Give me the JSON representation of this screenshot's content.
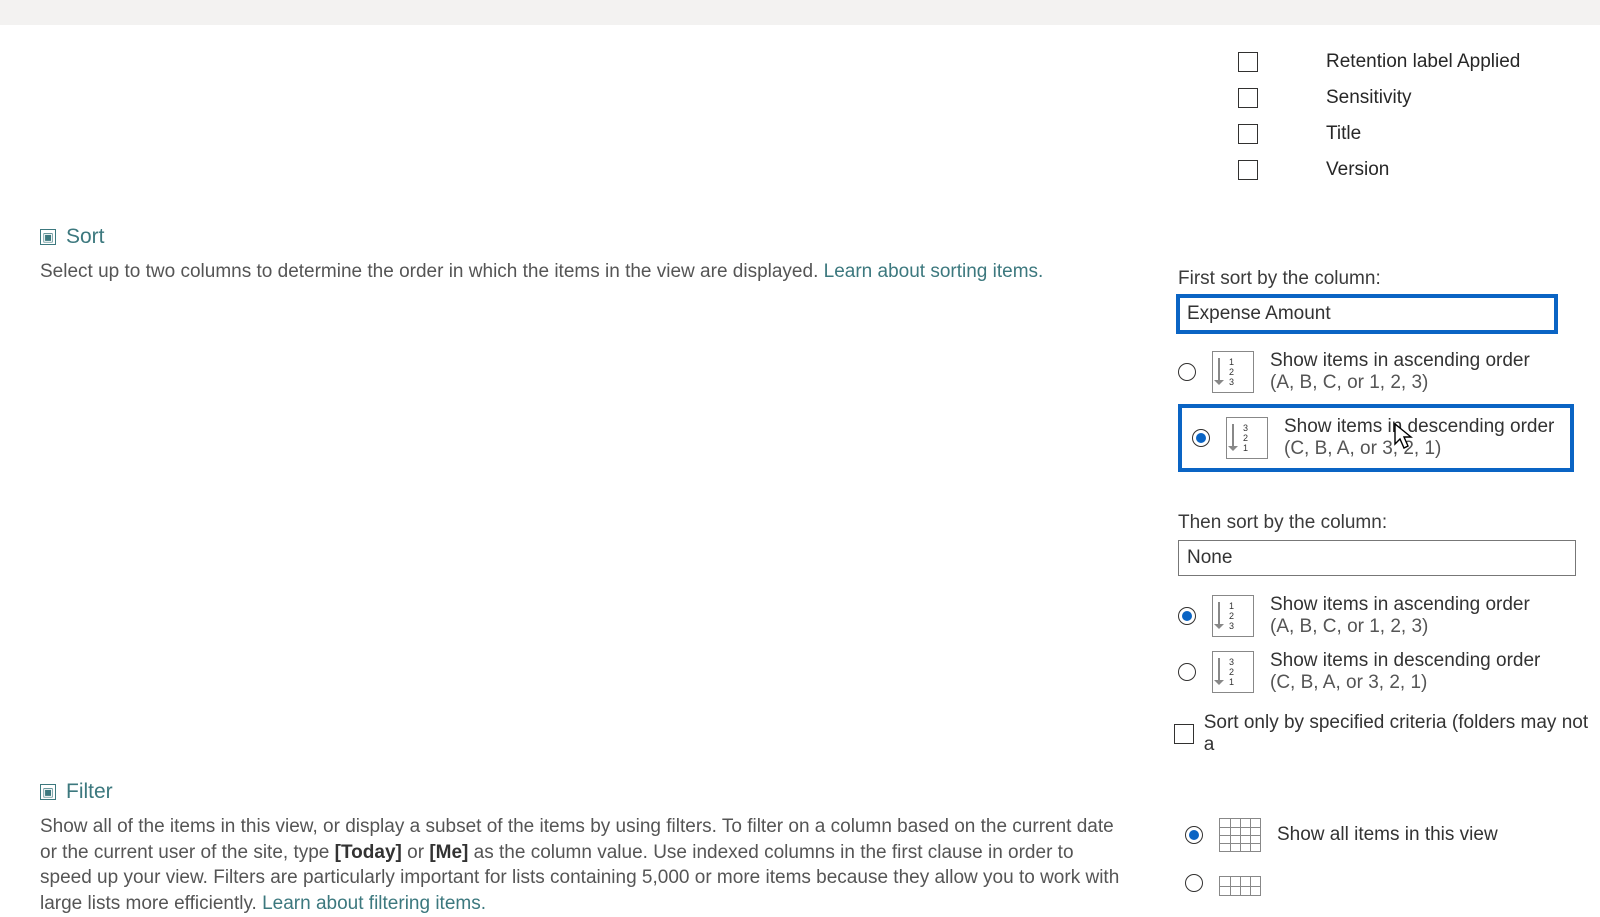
{
  "checkbox_columns": [
    {
      "label": "Retention label Applied",
      "checked": false
    },
    {
      "label": "Sensitivity",
      "checked": false
    },
    {
      "label": "Title",
      "checked": false
    },
    {
      "label": "Version",
      "checked": false
    }
  ],
  "sort": {
    "title": "Sort",
    "description": "Select up to two columns to determine the order in which the items in the view are displayed. ",
    "learn": "Learn about sorting items.",
    "first_label": "First sort by the column:",
    "first_value": "Expense Amount",
    "second_label": "Then sort by the column:",
    "second_value": "None",
    "asc_text": "Show items in ascending order",
    "asc_sub": "(A, B, C, or 1, 2, 3)",
    "desc_text": "Show items in descending order",
    "desc_sub": "(C, B, A, or 3, 2, 1)",
    "sort_only": "Sort only by specified criteria (folders may not a"
  },
  "filter": {
    "title": "Filter",
    "body_pre": "Show all of the items in this view, or display a subset of the items by using filters. To filter on a column based on the current date or the current user of the site, type ",
    "today": "[Today]",
    "or": " or ",
    "me": "[Me]",
    "body_post": " as the column value. Use indexed columns in the first clause in order to speed up your view. Filters are particularly important for lists containing 5,000 or more items because they allow you to work with large lists more efficiently. ",
    "learn": "Learn about filtering items.",
    "show_all": "Show all items in this view"
  }
}
